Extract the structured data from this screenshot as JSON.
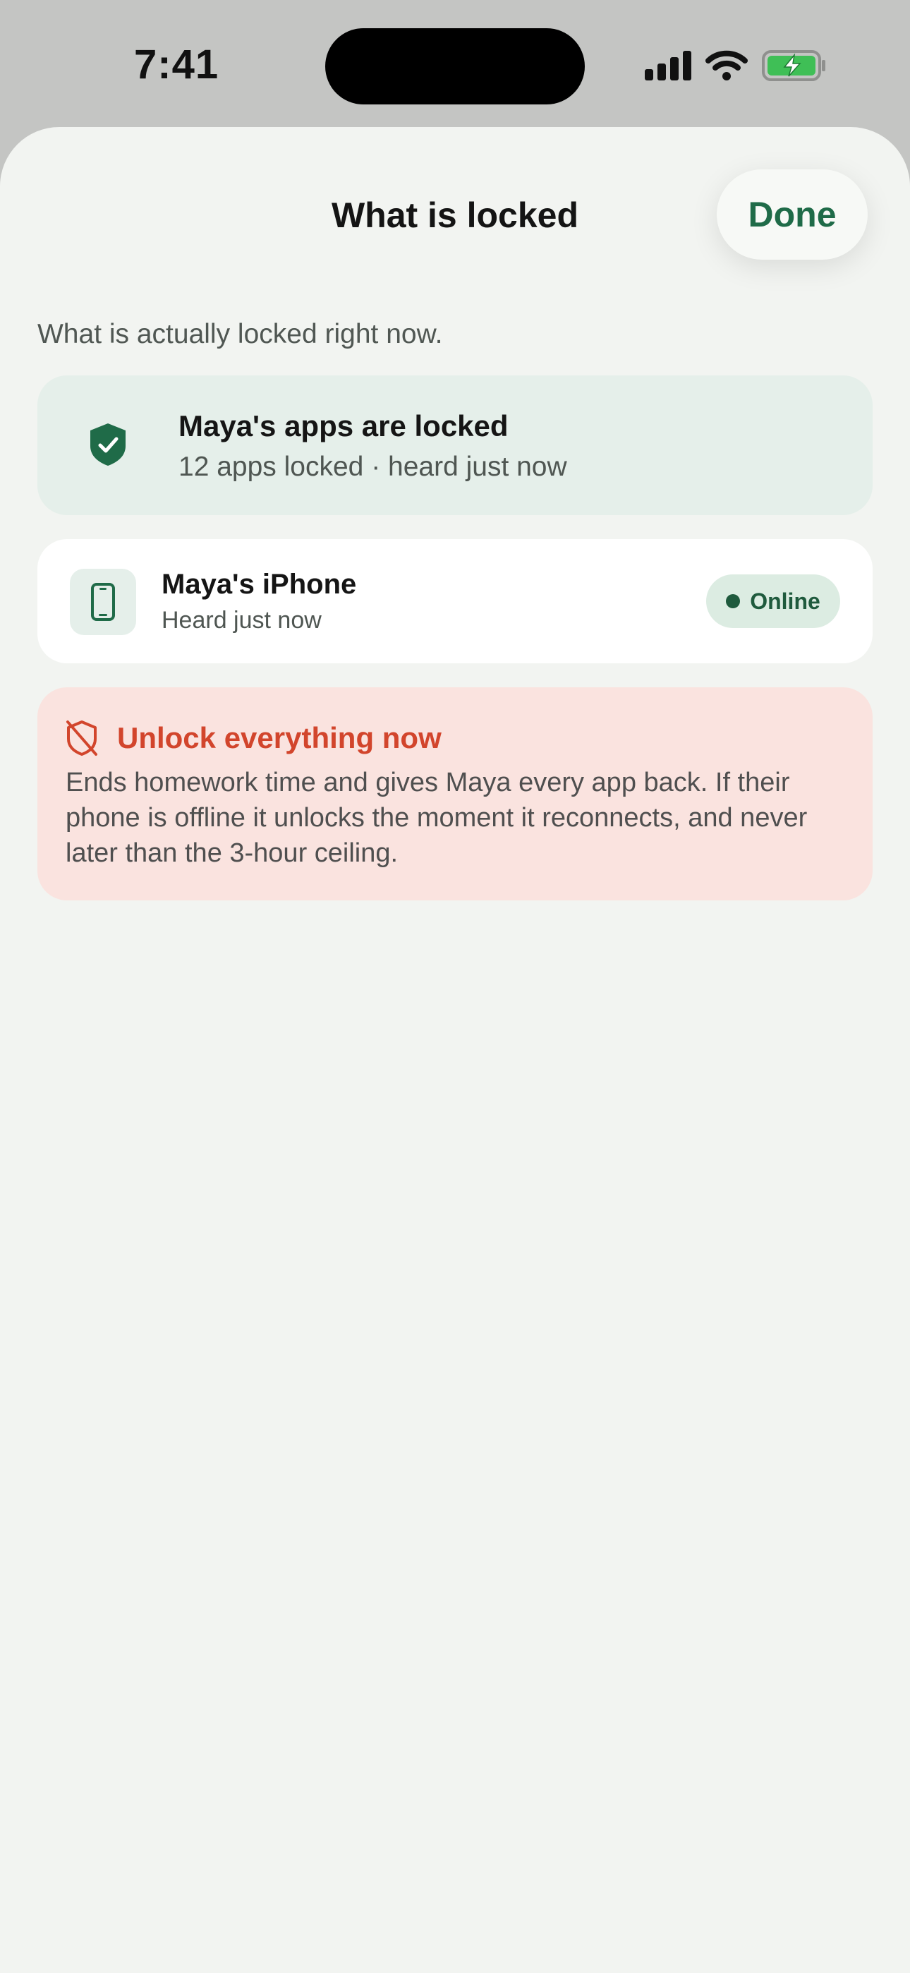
{
  "status_bar": {
    "time": "7:41",
    "icons": [
      "cellular-signal-icon",
      "wifi-icon",
      "battery-charging-icon"
    ]
  },
  "sheet": {
    "title": "What is locked",
    "done_label": "Done",
    "subtitle": "What is actually locked right now."
  },
  "locked_card": {
    "icon": "shield-check-icon",
    "title": "Maya's apps are locked",
    "subtitle": "12 apps locked · heard just now"
  },
  "device_card": {
    "icon": "phone-icon",
    "name": "Maya's iPhone",
    "heard": "Heard just now",
    "status": "Online"
  },
  "unlock_card": {
    "icon": "shield-off-icon",
    "title": "Unlock everything now",
    "description": "Ends homework time and gives Maya every app back. If their phone is offline it unlocks the moment it reconnects, and never later than the 3-hour ceiling."
  },
  "colors": {
    "accent": "#1f6b48",
    "danger": "#d2452c",
    "battery": "#3fbf56",
    "sheet_bg": "#f2f4f1"
  }
}
